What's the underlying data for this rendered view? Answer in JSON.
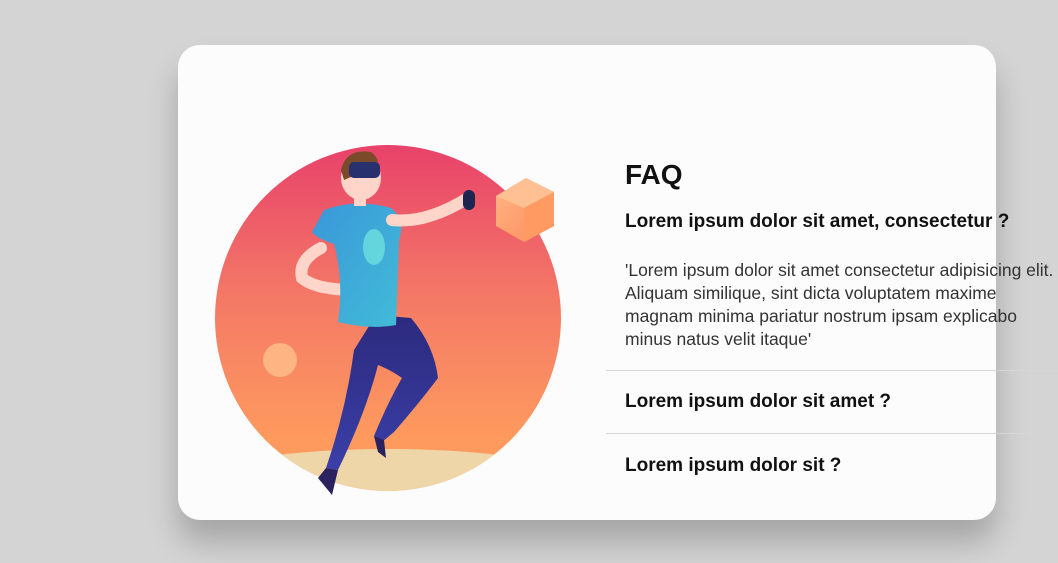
{
  "faq": {
    "title": "FAQ",
    "items": [
      {
        "question": "Lorem ipsum dolor sit amet, consectetur ?",
        "answer": "'Lorem ipsum dolor sit amet consectetur adipisicing elit. Aliquam similique, sint dicta voluptatem maxime magnam minima pariatur nostrum ipsam explicabo minus natus velit itaque'",
        "expanded": true
      },
      {
        "question": "Lorem ipsum dolor sit amet ?",
        "expanded": false
      },
      {
        "question": "Lorem ipsum dolor sit ?",
        "expanded": false
      }
    ]
  },
  "colors": {
    "accent_arrow": "#ef4b3c",
    "collapsed_arrow": "#a8a8a8",
    "card_background": "#fcfcfc",
    "page_background": "#d4d4d4"
  },
  "icons": {
    "expanded": "caret-down-icon",
    "collapsed": "caret-down-icon"
  }
}
